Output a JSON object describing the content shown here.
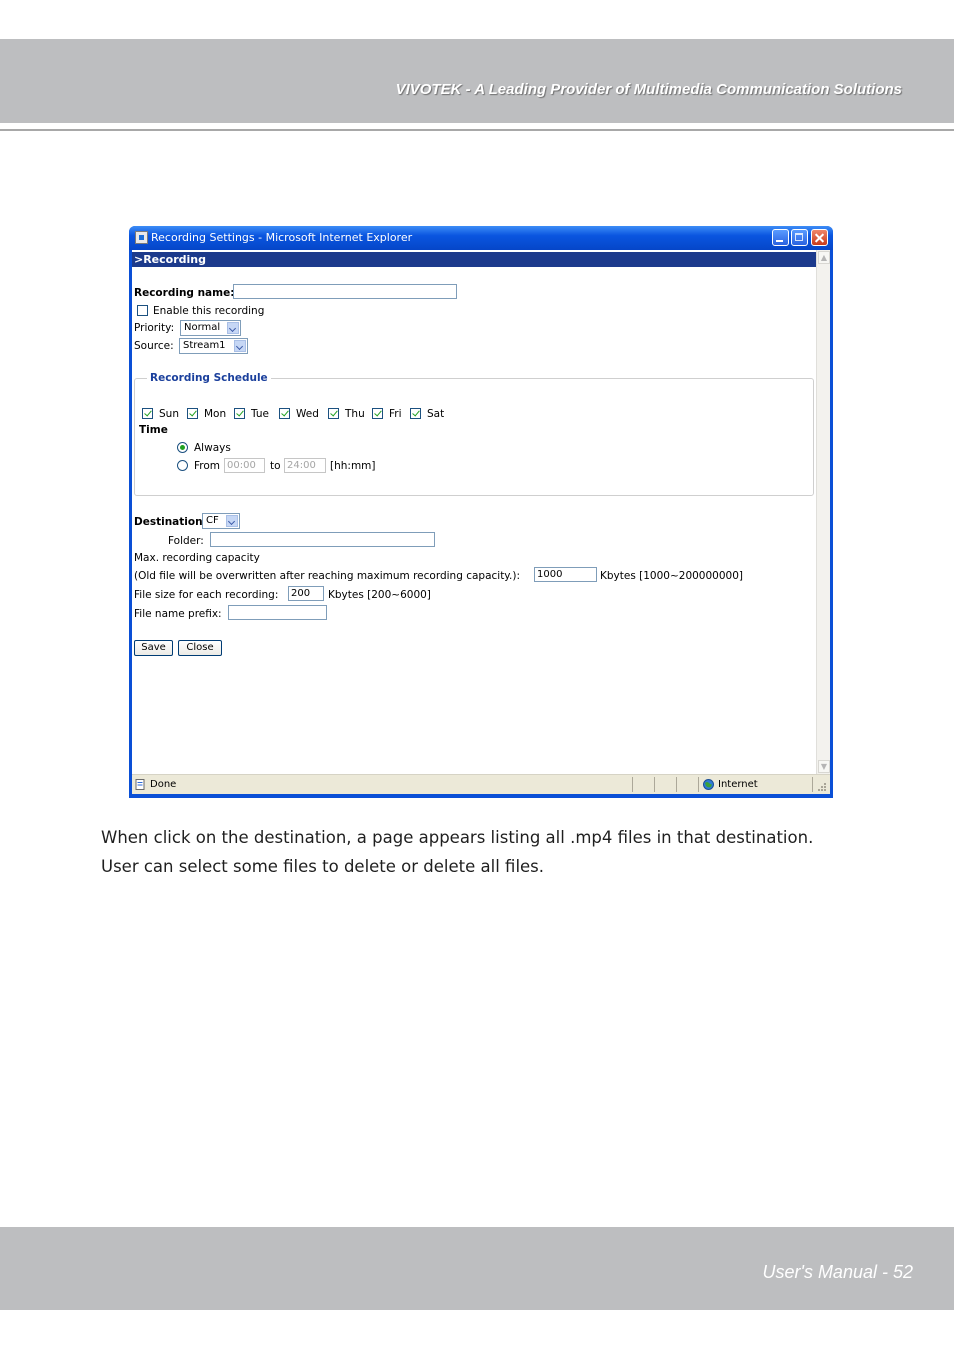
{
  "header": {
    "tagline": "VIVOTEK - A Leading Provider of Multimedia Communication Solutions"
  },
  "window": {
    "title": "Recording Settings - Microsoft Internet Explorer",
    "section_title": ">Recording",
    "form": {
      "recording_name_label": "Recording name:",
      "recording_name_value": "",
      "enable_label": "Enable this recording",
      "enable_checked": false,
      "priority_label": "Priority:",
      "priority_value": "Normal",
      "source_label": "Source:",
      "source_value": "Stream1"
    },
    "schedule": {
      "legend": "Recording Schedule",
      "days": [
        "Sun",
        "Mon",
        "Tue",
        "Wed",
        "Thu",
        "Fri",
        "Sat"
      ],
      "time_label": "Time",
      "always_label": "Always",
      "from_label": "From",
      "from_value": "00:00",
      "to_label": "to",
      "to_value": "24:00",
      "format_hint": "[hh:mm]"
    },
    "destination": {
      "label": "Destination",
      "value": "CF",
      "folder_label": "Folder:",
      "folder_value": "",
      "max_capacity_label": "Max. recording capacity",
      "overwrite_label": "(Old file will be overwritten after reaching maximum recording capacity.):",
      "capacity_value": "1000",
      "capacity_unit": "Kbytes [1000~200000000]",
      "file_size_label": "File size for each recording:",
      "file_size_value": "200",
      "file_size_unit": "Kbytes [200~6000]",
      "prefix_label": "File name prefix:",
      "prefix_value": ""
    },
    "buttons": {
      "save": "Save",
      "close": "Close"
    },
    "status": {
      "left": "Done",
      "zone": "Internet"
    }
  },
  "body": {
    "line1": "When click on the destination, a page appears listing all .mp4 files in that destination.",
    "line2": "User can select some files to delete or delete all files."
  },
  "footer": {
    "page_label": "User's Manual - 52"
  }
}
